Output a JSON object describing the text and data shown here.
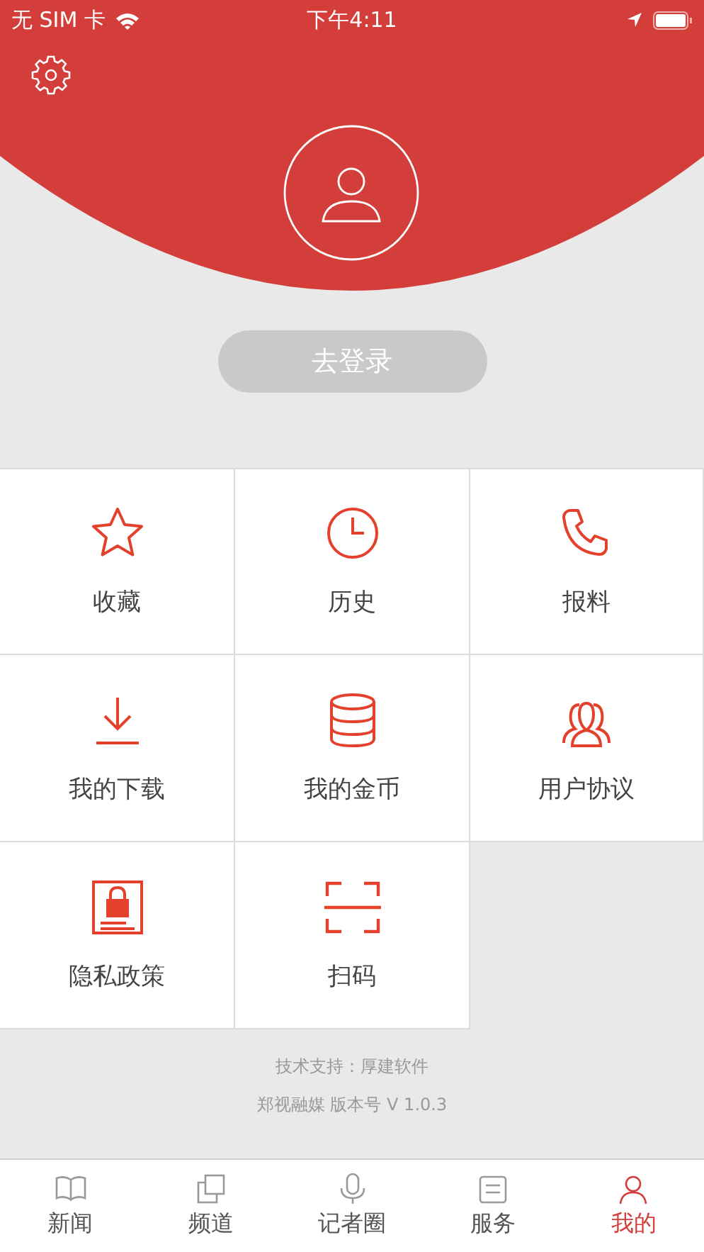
{
  "status_bar": {
    "carrier": "无 SIM 卡",
    "time": "下午4:11"
  },
  "login_button": "去登录",
  "grid": [
    {
      "label": "收藏"
    },
    {
      "label": "历史"
    },
    {
      "label": "报料"
    },
    {
      "label": "我的下载"
    },
    {
      "label": "我的金币"
    },
    {
      "label": "用户协议"
    },
    {
      "label": "隐私政策"
    },
    {
      "label": "扫码"
    }
  ],
  "footer": [
    "技术支持：厚建软件",
    "郑视融媒 版本号 V 1.0.3"
  ],
  "tabs": [
    {
      "label": "新闻",
      "selected": false
    },
    {
      "label": "频道",
      "selected": false
    },
    {
      "label": "记者圈",
      "selected": false
    },
    {
      "label": "服务",
      "selected": false
    },
    {
      "label": "我的",
      "selected": true
    }
  ]
}
